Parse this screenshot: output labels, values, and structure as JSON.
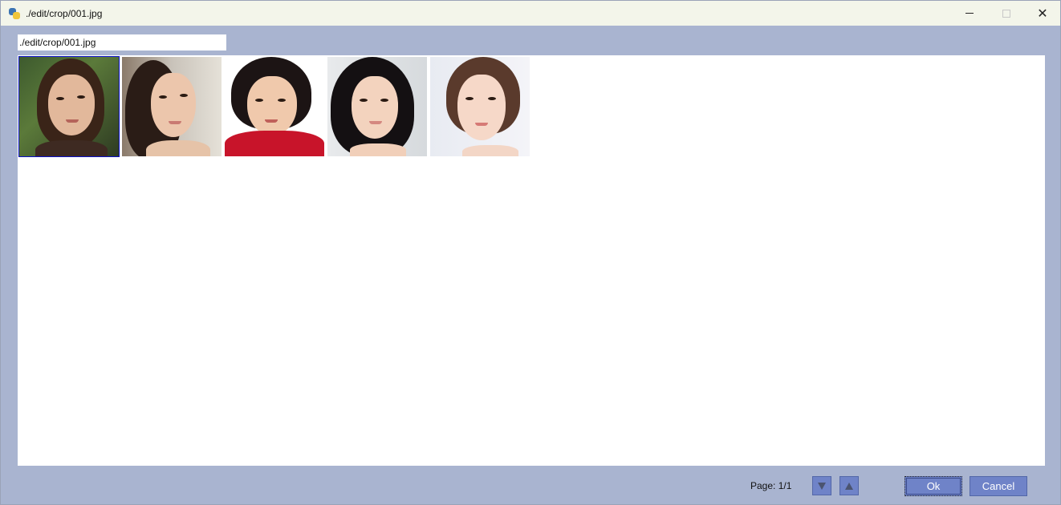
{
  "window": {
    "title": "./edit/crop/001.jpg"
  },
  "path_field": {
    "value": "./edit/crop/001.jpg"
  },
  "thumbnails": [
    {
      "index": 1,
      "selected": true
    },
    {
      "index": 2,
      "selected": false
    },
    {
      "index": 3,
      "selected": false
    },
    {
      "index": 4,
      "selected": false
    },
    {
      "index": 5,
      "selected": false
    }
  ],
  "footer": {
    "page_label": "Page:  1/1",
    "ok_label": "Ok",
    "cancel_label": "Cancel"
  },
  "colors": {
    "window_bg": "#a9b4d0",
    "button_bg": "#6f83c8",
    "selection": "#0a10c8"
  },
  "icons": {
    "app": "python-icon",
    "minimize": "minimize-icon",
    "maximize": "maximize-icon",
    "close": "close-icon",
    "page_down": "triangle-down-icon",
    "page_up": "triangle-up-icon"
  }
}
